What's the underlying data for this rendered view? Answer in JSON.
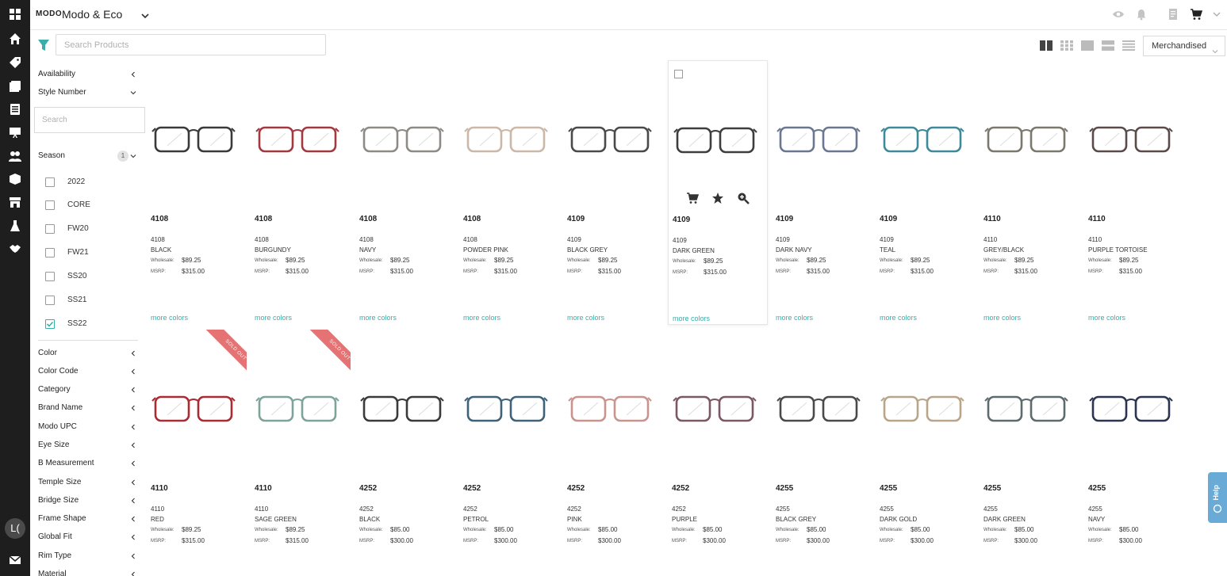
{
  "app": {
    "logo_text": "MODO",
    "account_name": "Modo & Eco"
  },
  "search": {
    "placeholder": "Search Products",
    "value": ""
  },
  "sort": {
    "selected": "Merchandised"
  },
  "filters": {
    "facets_top": [
      {
        "label": "Availability",
        "state": "collapsed"
      },
      {
        "label": "Style Number",
        "state": "expanded"
      }
    ],
    "style_search_placeholder": "Search",
    "season": {
      "label": "Season",
      "count": "1",
      "options": [
        {
          "label": "2022",
          "checked": false
        },
        {
          "label": "CORE",
          "checked": false
        },
        {
          "label": "FW20",
          "checked": false
        },
        {
          "label": "FW21",
          "checked": false
        },
        {
          "label": "SS20",
          "checked": false
        },
        {
          "label": "SS21",
          "checked": false
        },
        {
          "label": "SS22",
          "checked": true
        }
      ]
    },
    "facets_bottom": [
      {
        "label": "Color"
      },
      {
        "label": "Color Code"
      },
      {
        "label": "Category"
      },
      {
        "label": "Brand Name"
      },
      {
        "label": "Modo UPC"
      },
      {
        "label": "Eye Size"
      },
      {
        "label": "B Measurement"
      },
      {
        "label": "Temple Size"
      },
      {
        "label": "Bridge Size"
      },
      {
        "label": "Frame Shape"
      },
      {
        "label": "Global Fit"
      },
      {
        "label": "Rim Type"
      },
      {
        "label": "Material"
      }
    ]
  },
  "labels": {
    "wholesale": "Wholesale:",
    "msrp": "MSRP:",
    "more_colors": "more colors",
    "sold_out": "SOLD OUT"
  },
  "user": {
    "initials": "L("
  },
  "help": {
    "label": "Help"
  },
  "colors": {
    "accent": "#3aafa9",
    "sold_out": "#e57373",
    "rail": "#1e1e1e",
    "help": "#6aaad7"
  },
  "products": [
    {
      "style": "4108",
      "code": "4108",
      "color": "BLACK",
      "wholesale": "$89.25",
      "msrp": "$315.00",
      "frame": "#3a3a3a",
      "sold_out": false
    },
    {
      "style": "4108",
      "code": "4108",
      "color": "BURGUNDY",
      "wholesale": "$89.25",
      "msrp": "$315.00",
      "frame": "#a3393e",
      "sold_out": false
    },
    {
      "style": "4108",
      "code": "4108",
      "color": "NAVY",
      "wholesale": "$89.25",
      "msrp": "$315.00",
      "frame": "#8e8a86",
      "sold_out": false
    },
    {
      "style": "4108",
      "code": "4108",
      "color": "POWDER PINK",
      "wholesale": "$89.25",
      "msrp": "$315.00",
      "frame": "#cbb8a8",
      "sold_out": false
    },
    {
      "style": "4109",
      "code": "4109",
      "color": "BLACK GREY",
      "wholesale": "$89.25",
      "msrp": "$315.00",
      "frame": "#4a4a4a",
      "sold_out": false
    },
    {
      "style": "4109",
      "code": "4109",
      "color": "DARK GREEN",
      "wholesale": "$89.25",
      "msrp": "$315.00",
      "frame": "#3c3f3c",
      "sold_out": false,
      "highlight": true
    },
    {
      "style": "4109",
      "code": "4109",
      "color": "DARK NAVY",
      "wholesale": "$89.25",
      "msrp": "$315.00",
      "frame": "#6b7791",
      "sold_out": false
    },
    {
      "style": "4109",
      "code": "4109",
      "color": "TEAL",
      "wholesale": "$89.25",
      "msrp": "$315.00",
      "frame": "#3f8a9a",
      "sold_out": false
    },
    {
      "style": "4110",
      "code": "4110",
      "color": "GREY/BLACK",
      "wholesale": "$89.25",
      "msrp": "$315.00",
      "frame": "#7b786d",
      "sold_out": false
    },
    {
      "style": "4110",
      "code": "4110",
      "color": "PURPLE TORTOISE",
      "wholesale": "$89.25",
      "msrp": "$315.00",
      "frame": "#5b4a4a",
      "sold_out": false
    },
    {
      "style": "4110",
      "code": "4110",
      "color": "RED",
      "wholesale": "$89.25",
      "msrp": "$315.00",
      "frame": "#a92b33",
      "sold_out": true
    },
    {
      "style": "4110",
      "code": "4110",
      "color": "SAGE GREEN",
      "wholesale": "$89.25",
      "msrp": "$315.00",
      "frame": "#7ea39a",
      "sold_out": true
    },
    {
      "style": "4252",
      "code": "4252",
      "color": "BLACK",
      "wholesale": "$85.00",
      "msrp": "$300.00",
      "frame": "#3a3a3a",
      "sold_out": false
    },
    {
      "style": "4252",
      "code": "4252",
      "color": "PETROL",
      "wholesale": "$85.00",
      "msrp": "$300.00",
      "frame": "#3e6278",
      "sold_out": false
    },
    {
      "style": "4252",
      "code": "4252",
      "color": "PINK",
      "wholesale": "$85.00",
      "msrp": "$300.00",
      "frame": "#c9948e",
      "sold_out": false
    },
    {
      "style": "4252",
      "code": "4252",
      "color": "PURPLE",
      "wholesale": "$85.00",
      "msrp": "$300.00",
      "frame": "#7b5866",
      "sold_out": false
    },
    {
      "style": "4255",
      "code": "4255",
      "color": "BLACK GREY",
      "wholesale": "$85.00",
      "msrp": "$300.00",
      "frame": "#4a4a4a",
      "sold_out": false
    },
    {
      "style": "4255",
      "code": "4255",
      "color": "DARK GOLD",
      "wholesale": "$85.00",
      "msrp": "$300.00",
      "frame": "#b9a58a",
      "sold_out": false
    },
    {
      "style": "4255",
      "code": "4255",
      "color": "DARK GREEN",
      "wholesale": "$85.00",
      "msrp": "$300.00",
      "frame": "#5d6b6e",
      "sold_out": false
    },
    {
      "style": "4255",
      "code": "4255",
      "color": "NAVY",
      "wholesale": "$85.00",
      "msrp": "$300.00",
      "frame": "#2b3550",
      "sold_out": false
    }
  ]
}
